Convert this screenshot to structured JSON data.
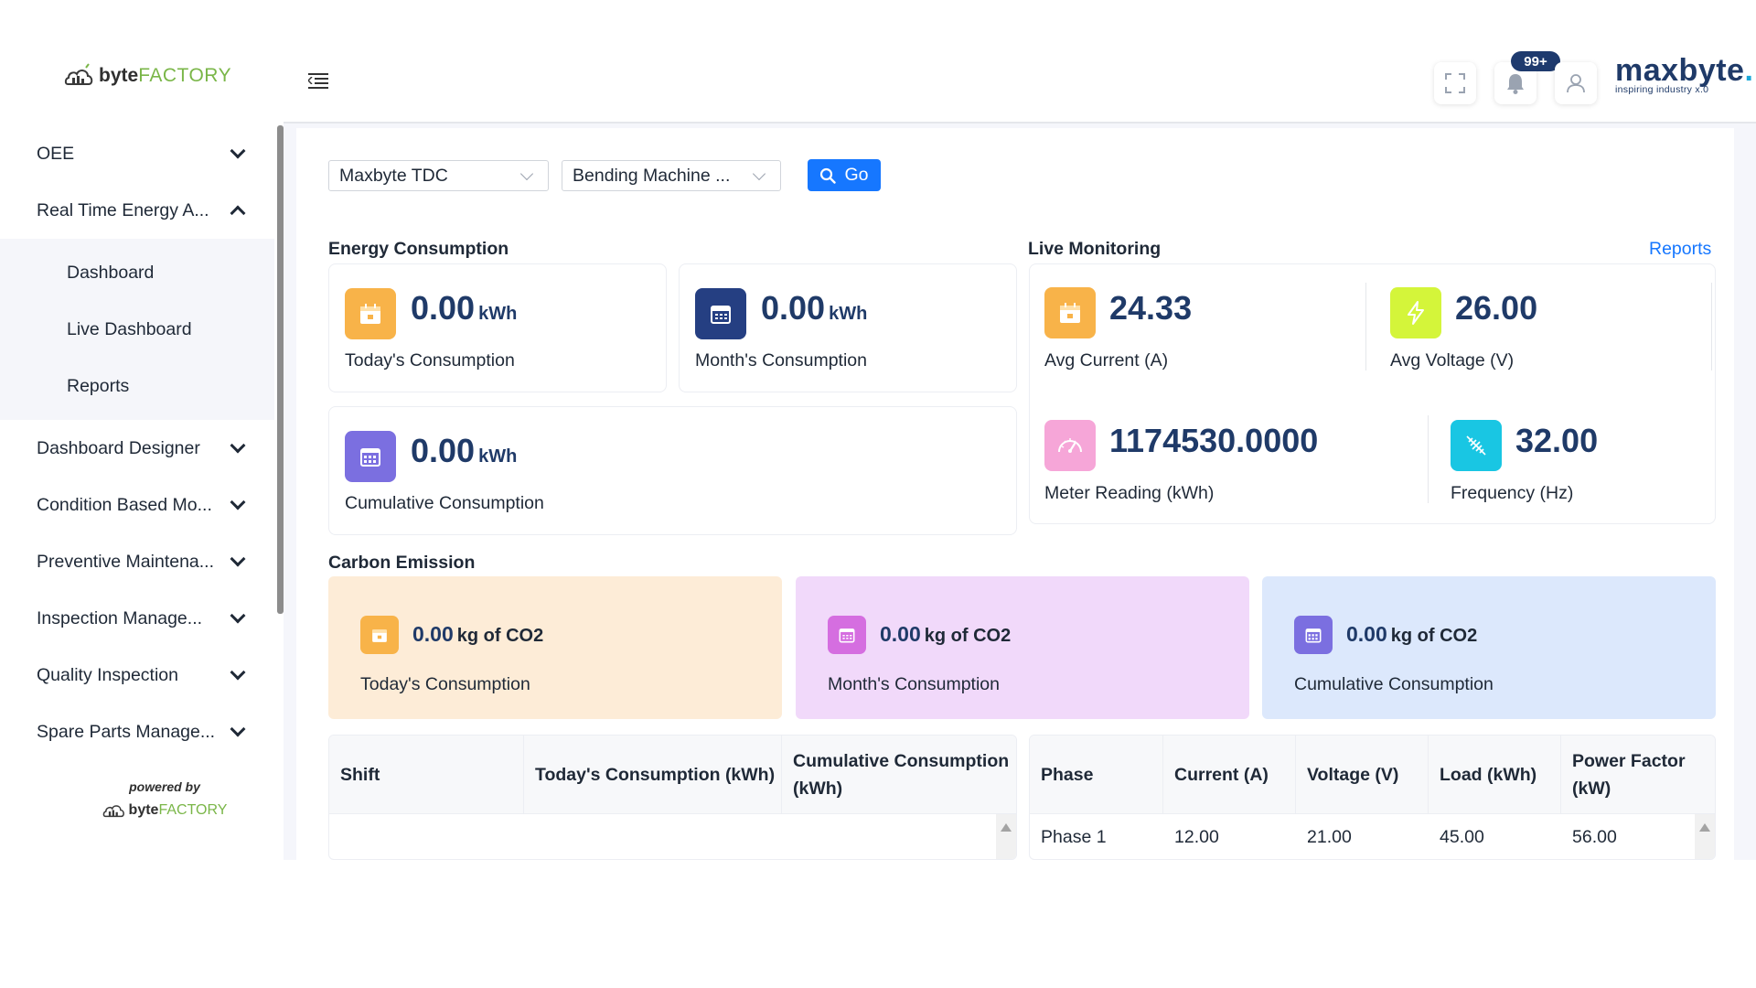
{
  "sidebar": {
    "logo": {
      "bold": "byte",
      "light": "FACTORY"
    },
    "items": [
      {
        "label": "OEE"
      },
      {
        "label": "Real Time Energy A..."
      },
      {
        "label": "Dashboard Designer"
      },
      {
        "label": "Condition Based Mo..."
      },
      {
        "label": "Preventive Maintena..."
      },
      {
        "label": "Inspection Manage..."
      },
      {
        "label": "Quality Inspection"
      },
      {
        "label": "Spare Parts Manage..."
      }
    ],
    "sub_items": [
      {
        "label": "Dashboard"
      },
      {
        "label": "Live Dashboard"
      },
      {
        "label": "Reports"
      }
    ],
    "powered_by": "powered by"
  },
  "header": {
    "notification_count": "99+",
    "brand": {
      "name": "maxbyte",
      "dot": ".",
      "tagline": "inspiring industry x.0"
    }
  },
  "filters": {
    "plant": "Maxbyte TDC",
    "machine": "Bending Machine ...",
    "go_label": "Go"
  },
  "energy": {
    "title": "Energy Consumption",
    "today": {
      "value": "0.00",
      "unit": "kWh",
      "label": "Today's Consumption"
    },
    "month": {
      "value": "0.00",
      "unit": "kWh",
      "label": "Month's Consumption"
    },
    "cumulative": {
      "value": "0.00",
      "unit": "kWh",
      "label": "Cumulative Consumption"
    }
  },
  "live": {
    "title": "Live Monitoring",
    "reports_link": "Reports",
    "avg_current": {
      "value": "24.33",
      "label": "Avg Current (A)"
    },
    "avg_voltage": {
      "value": "26.00",
      "label": "Avg Voltage (V)"
    },
    "meter_reading": {
      "value": "1174530.0000",
      "label": "Meter Reading (kWh)"
    },
    "frequency": {
      "value": "32.00",
      "label": "Frequency (Hz)"
    }
  },
  "carbon": {
    "title": "Carbon Emission",
    "today": {
      "value": "0.00",
      "unit": "kg of CO2",
      "label": "Today's Consumption"
    },
    "month": {
      "value": "0.00",
      "unit": "kg of CO2",
      "label": "Month's Consumption"
    },
    "cumulative": {
      "value": "0.00",
      "unit": "kg of CO2",
      "label": "Cumulative Consumption"
    }
  },
  "shift_table": {
    "headers": [
      "Shift",
      "Today's Consumption (kWh)",
      "Cumulative Consumption (kWh)"
    ]
  },
  "phase_table": {
    "headers": [
      "Phase",
      "Current (A)",
      "Voltage (V)",
      "Load (kWh)",
      "Power Factor (kW)"
    ],
    "rows": [
      [
        "Phase 1",
        "12.00",
        "21.00",
        "45.00",
        "56.00"
      ]
    ]
  },
  "colors": {
    "primary": "#1677ff",
    "navy": "#1f3a68",
    "orange": "#f8b349",
    "lime": "#d4f53a",
    "pink": "#f6a6d8",
    "cyan": "#19c6e3",
    "purple": "#7b6fe0",
    "magenta": "#d56ee0"
  }
}
